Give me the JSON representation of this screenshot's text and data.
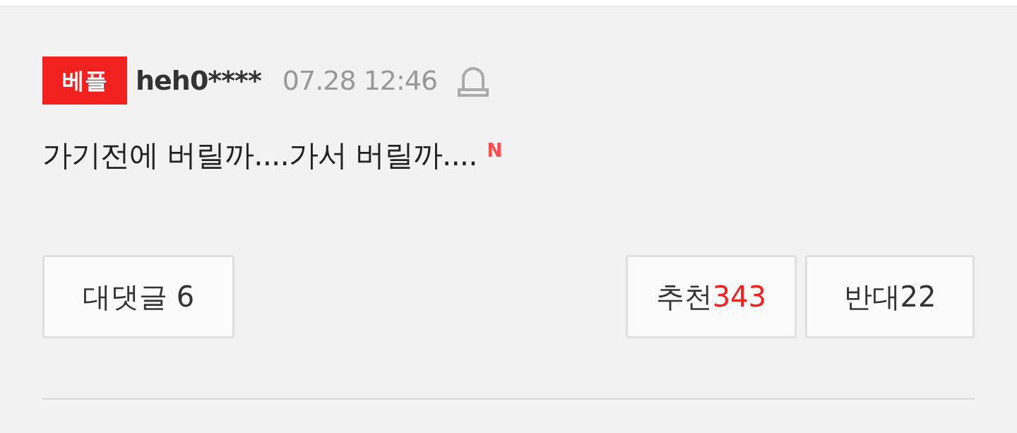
{
  "comment": {
    "badge": "베플",
    "author": "heh0****",
    "date": "07.28 12:46",
    "text": "가기전에 버릴까....가서 버릴까....",
    "new_mark": "N"
  },
  "reply_button": {
    "label": "대댓글",
    "count": "6"
  },
  "votes": [
    {
      "kind": "up",
      "label": "추천",
      "count": "343"
    },
    {
      "kind": "down",
      "label": "반대",
      "count": "22"
    }
  ]
}
